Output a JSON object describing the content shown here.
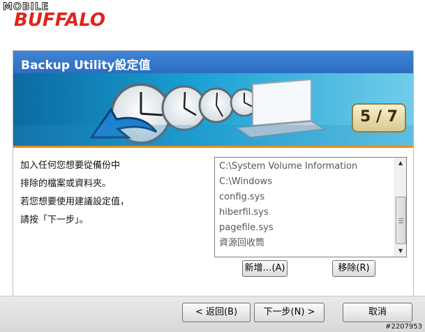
{
  "brand": {
    "line1": "MOBILE",
    "line2": "BUFFALO"
  },
  "panel": {
    "title": "Backup Utility設定值",
    "step": "5 / 7",
    "instructions": [
      "加入任何您想要從備份中",
      "排除的檔案或資料夾。",
      "若您想要使用建議設定值，",
      "請按「下一步」。"
    ],
    "exclusions": [
      "C:\\System Volume Information",
      "C:\\Windows",
      "config.sys",
      "hiberfil.sys",
      "pagefile.sys",
      "資源回收筒"
    ],
    "add_label": "新增…(A)",
    "remove_label": "移除(R)"
  },
  "nav": {
    "back_label": "< 返回(B)",
    "next_label": "下一步(N) >",
    "cancel_label": "取消"
  },
  "watermark": "#2207953",
  "colors": {
    "title_bar": "#2d6dc2",
    "banner": "#19a0d3",
    "accent_orange": "#f28c0f",
    "brand_red": "#e2231a"
  },
  "icons": [
    "clock-icon",
    "laptop-icon",
    "arrow-icon"
  ]
}
